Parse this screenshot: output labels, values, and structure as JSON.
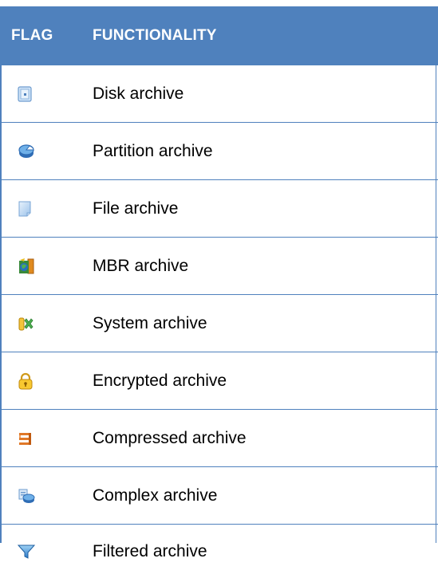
{
  "table": {
    "headers": {
      "flag": "FLAG",
      "functionality": "FUNCTIONALITY"
    },
    "rows": [
      {
        "icon": "disk-icon",
        "label": "Disk archive"
      },
      {
        "icon": "partition-icon",
        "label": "Partition archive"
      },
      {
        "icon": "file-icon",
        "label": "File archive"
      },
      {
        "icon": "mbr-icon",
        "label": "MBR archive"
      },
      {
        "icon": "system-icon",
        "label": "System archive"
      },
      {
        "icon": "lock-icon",
        "label": "Encrypted archive"
      },
      {
        "icon": "compress-icon",
        "label": "Compressed archive"
      },
      {
        "icon": "complex-icon",
        "label": "Complex archive"
      },
      {
        "icon": "filter-icon",
        "label": "Filtered archive"
      }
    ]
  },
  "colors": {
    "header_bg": "#4f81bd",
    "header_text": "#ffffff",
    "border": "#4f81bd"
  }
}
